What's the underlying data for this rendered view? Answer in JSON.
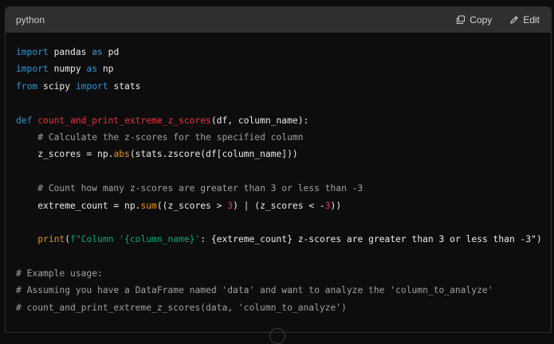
{
  "header": {
    "language": "python",
    "copy_label": "Copy",
    "edit_label": "Edit"
  },
  "colors": {
    "keyword": "#2e95d3",
    "function_name": "#f22c3d",
    "builtin": "#e9950c",
    "number": "#df3079",
    "string": "#00a67d",
    "comment": "#a0a0a0",
    "text": "#ececec",
    "header_bg": "#2f2f2f",
    "code_bg": "#0d0d0d"
  },
  "icons": {
    "copy": "copy-icon",
    "edit": "pencil-icon"
  },
  "code": [
    [
      {
        "t": "kw",
        "v": "import"
      },
      {
        "t": "txt",
        "v": " pandas "
      },
      {
        "t": "kw",
        "v": "as"
      },
      {
        "t": "txt",
        "v": " pd"
      }
    ],
    [
      {
        "t": "kw",
        "v": "import"
      },
      {
        "t": "txt",
        "v": " numpy "
      },
      {
        "t": "kw",
        "v": "as"
      },
      {
        "t": "txt",
        "v": " np"
      }
    ],
    [
      {
        "t": "kw",
        "v": "from"
      },
      {
        "t": "txt",
        "v": " scipy "
      },
      {
        "t": "kw",
        "v": "import"
      },
      {
        "t": "txt",
        "v": " stats"
      }
    ],
    [],
    [
      {
        "t": "kw",
        "v": "def"
      },
      {
        "t": "txt",
        "v": " "
      },
      {
        "t": "fn",
        "v": "count_and_print_extreme_z_scores"
      },
      {
        "t": "txt",
        "v": "(df, column_name):"
      }
    ],
    [
      {
        "t": "txt",
        "v": "    "
      },
      {
        "t": "cmt",
        "v": "# Calculate the z-scores for the specified column"
      }
    ],
    [
      {
        "t": "txt",
        "v": "    z_scores = np."
      },
      {
        "t": "bi",
        "v": "abs"
      },
      {
        "t": "txt",
        "v": "(stats.zscore(df[column_name]))"
      }
    ],
    [],
    [
      {
        "t": "txt",
        "v": "    "
      },
      {
        "t": "cmt",
        "v": "# Count how many z-scores are greater than 3 or less than -3"
      }
    ],
    [
      {
        "t": "txt",
        "v": "    extreme_count = np."
      },
      {
        "t": "bi",
        "v": "sum"
      },
      {
        "t": "txt",
        "v": "((z_scores > "
      },
      {
        "t": "num",
        "v": "3"
      },
      {
        "t": "txt",
        "v": ") | (z_scores < -"
      },
      {
        "t": "num",
        "v": "3"
      },
      {
        "t": "txt",
        "v": "))"
      }
    ],
    [],
    [
      {
        "t": "txt",
        "v": "    "
      },
      {
        "t": "bi",
        "v": "print"
      },
      {
        "t": "txt",
        "v": "("
      },
      {
        "t": "str",
        "v": "f\"Column '{column_name}'"
      },
      {
        "t": "txt",
        "v": ": {extreme_count} z-scores are greater than 3 or less than -3\")"
      }
    ],
    [],
    [
      {
        "t": "cmt",
        "v": "# Example usage:"
      }
    ],
    [
      {
        "t": "cmt",
        "v": "# Assuming you have a DataFrame named 'data' and want to analyze the 'column_to_analyze'"
      }
    ],
    [
      {
        "t": "cmt",
        "v": "# count_and_print_extreme_z_scores(data, 'column_to_analyze')"
      }
    ]
  ]
}
